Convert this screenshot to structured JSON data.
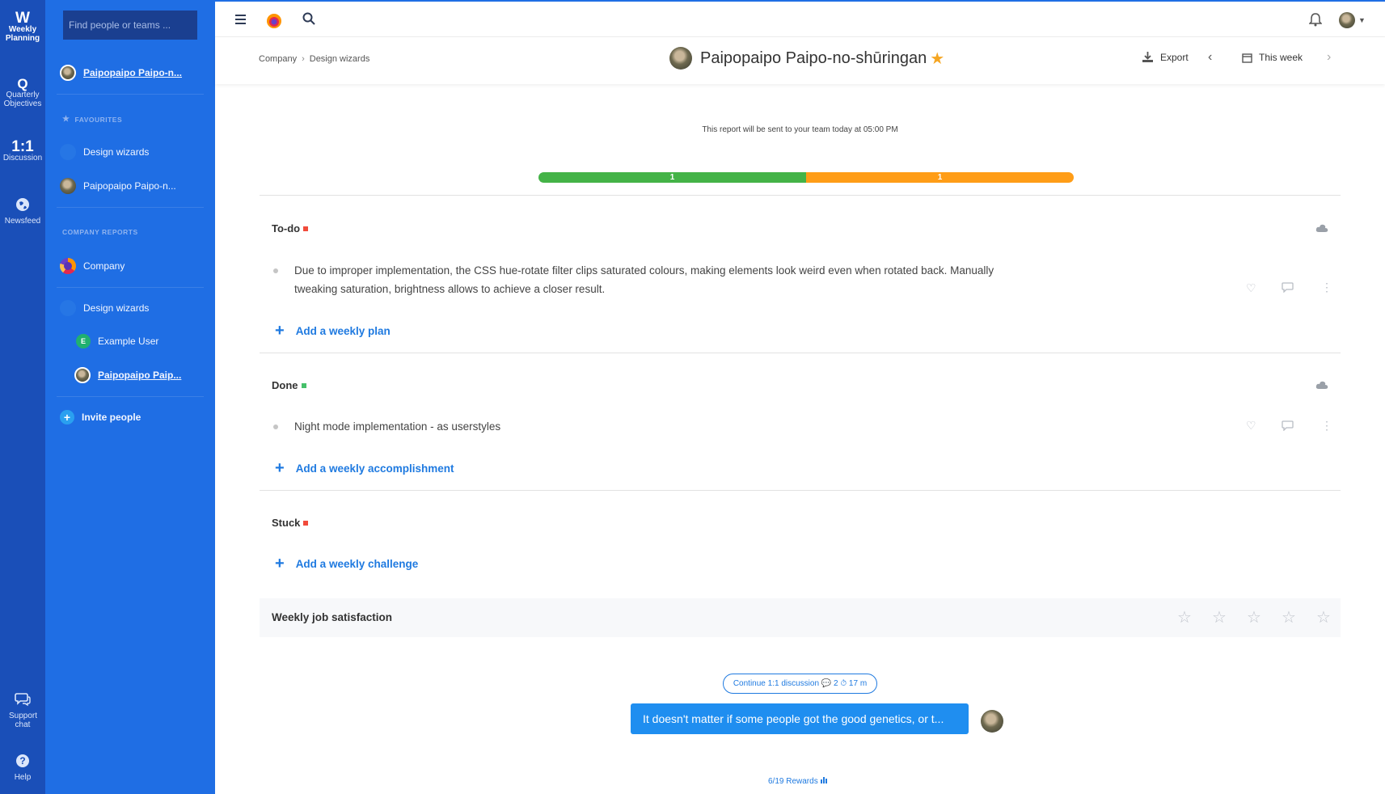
{
  "rail": {
    "items": [
      {
        "glyph": "W",
        "label": "Weekly Planning",
        "active": true
      },
      {
        "glyph": "Q",
        "label": "Quarterly Objectives"
      },
      {
        "glyph": "1:1",
        "label": "Discussion"
      },
      {
        "glyph": "globe-icon",
        "label": "Newsfeed"
      },
      {
        "glyph": "chat-icon",
        "label": "Support chat"
      },
      {
        "glyph": "help-icon",
        "label": "Help"
      }
    ]
  },
  "sidebar": {
    "search_placeholder": "Find people or teams ...",
    "current_user": "Paipopaipo Paipo-n...",
    "favourites_label": "FAVOURITES",
    "favourites": [
      "Design wizards",
      "Paipopaipo Paipo-n..."
    ],
    "company_reports_label": "COMPANY REPORTS",
    "company": "Company",
    "team": "Design wizards",
    "members": [
      {
        "initial": "E",
        "name": "Example User"
      },
      {
        "name": "Paipopaipo Paip..."
      }
    ],
    "invite": "Invite people"
  },
  "header": {
    "breadcrumb": [
      "Company",
      "Design wizards"
    ],
    "breadcrumb_sep": "›",
    "title": "Paipopaipo Paipo-no-shūringan",
    "export_label": "Export",
    "period_label": "This week"
  },
  "report": {
    "notice": "This report will be sent to your team today at 05:00 PM",
    "progress": [
      {
        "label": "1",
        "color": "#44b347",
        "fraction": 0.5
      },
      {
        "label": "1",
        "color": "#ff9d17",
        "fraction": 0.5
      }
    ],
    "sections": {
      "todo": {
        "title": "To-do",
        "items": [
          "Due to improper implementation, the CSS hue-rotate filter clips saturated colours, making elements look weird even when rotated back. Manually tweaking saturation, brightness allows to achieve a closer result."
        ],
        "add_label": "Add a weekly plan"
      },
      "done": {
        "title": "Done",
        "items": [
          "Night mode implementation - as userstyles"
        ],
        "add_label": "Add a weekly accomplishment"
      },
      "stuck": {
        "title": "Stuck",
        "add_label": "Add a weekly challenge"
      }
    },
    "satisfaction": {
      "label": "Weekly job satisfaction",
      "rating": 0,
      "max": 5
    }
  },
  "discussion": {
    "continue_label": "Continue 1:1 discussion 💬 2 ⏱ 17 m",
    "last_message": "It doesn't matter if some people got the good genetics, or t..."
  },
  "footer": {
    "rewards": "6/19 Rewards"
  },
  "colors": {
    "rail": "#1a4fb8",
    "sidebar": "#1f6ee4",
    "accent": "#1f7ae0"
  }
}
